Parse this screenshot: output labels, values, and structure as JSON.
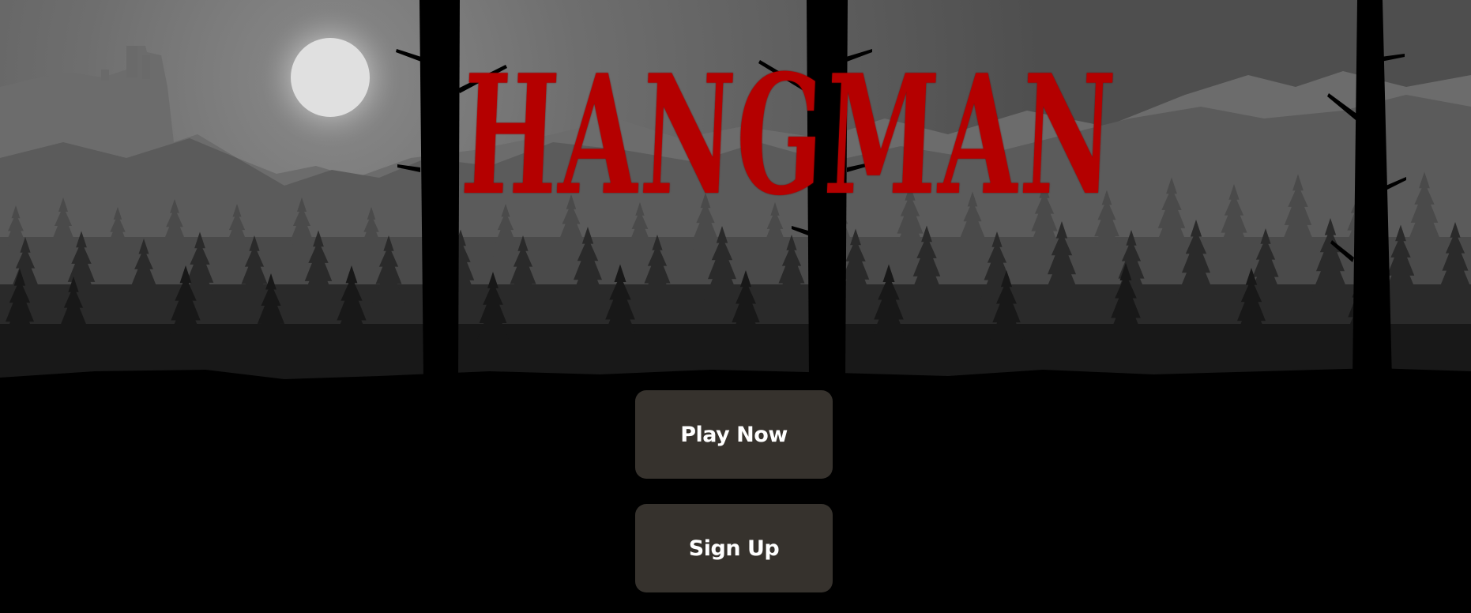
{
  "title": "HANGMAN",
  "buttons": {
    "play_label": "Play Now",
    "signup_label": "Sign Up"
  },
  "colors": {
    "title": "#b40000",
    "button_bg": "#36322d",
    "button_text": "#ffffff",
    "sky": "#5a5a5a",
    "ground": "#000000"
  }
}
